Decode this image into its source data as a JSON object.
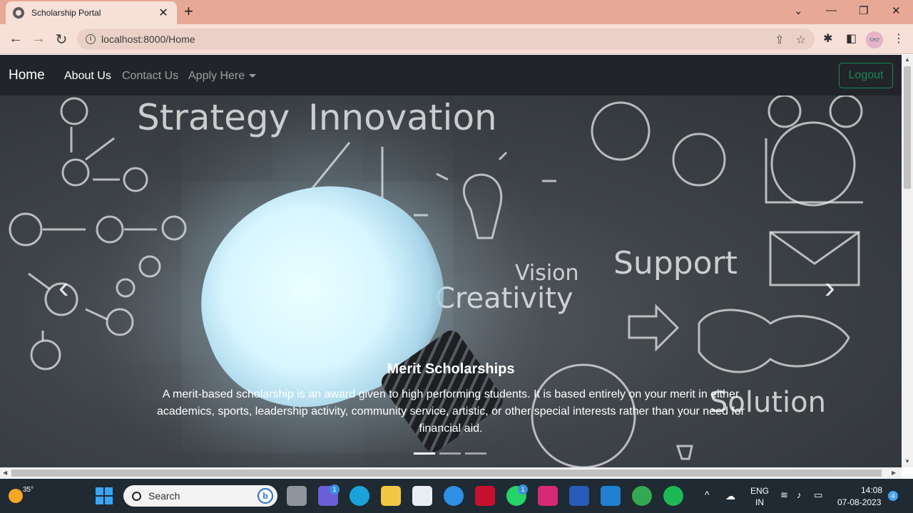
{
  "browser": {
    "tab_title": "Scholarship Portal",
    "tab_close": "✕",
    "new_tab": "+",
    "url": "localhost:8000/Home"
  },
  "navbar": {
    "brand": "Home",
    "links": [
      "About Us",
      "Contact Us",
      "Apply Here"
    ],
    "logout": "Logout"
  },
  "carousel": {
    "chalk_words": {
      "strategy": "Strategy",
      "innovation": "Innovation",
      "vision": "Vision",
      "creativity": "Creativity",
      "support": "Support",
      "solution": "Solution"
    },
    "caption_title": "Merit Scholarships",
    "caption_text": "A merit-based scholarship is an award given to high performing students. It is based entirely on your merit in either academics, sports, leadership activity, community service, artistic, or other special interests rather than your need for financial aid.",
    "slide_count": 3,
    "active_slide": 1
  },
  "taskbar": {
    "temperature": "35°",
    "search_placeholder": "Search",
    "lang_top": "ENG",
    "lang_bottom": "IN",
    "time": "14:08",
    "date": "07-08-2023",
    "notification_count": "4",
    "teams_badge": "1",
    "whatsapp_badge": "1"
  },
  "colors": {
    "navbar_bg": "#212529",
    "logout_green": "#198754",
    "tabbar": "#e7a996"
  }
}
